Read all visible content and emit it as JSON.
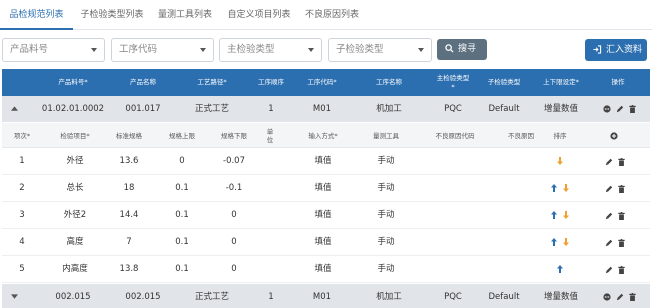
{
  "tabs": [
    {
      "label": "品检规范列表"
    },
    {
      "label": "子检验类型列表"
    },
    {
      "label": "量测工具列表"
    },
    {
      "label": "自定义项目列表"
    },
    {
      "label": "不良原因列表"
    }
  ],
  "filters": {
    "material_placeholder": "产品料号",
    "process_code_placeholder": "工序代码",
    "main_type_placeholder": "主检验类型",
    "sub_type_placeholder": "子检验类型",
    "search_label": "搜寻",
    "import_label": "汇入资料"
  },
  "columns": [
    "产品料号*",
    "产品名称",
    "工艺路径*",
    "工序顺序",
    "工序代码*",
    "工序名称",
    "主检验类型*",
    "子检验类型",
    "上下限设定*",
    "操作"
  ],
  "main_rows": [
    {
      "material": "01.02.01.0002",
      "name": "001.017",
      "route": "正式工艺",
      "seq": "1",
      "code": "M01",
      "process": "机加工",
      "main_type": "PQC",
      "sub_type": "Default",
      "limit": "增量数值"
    },
    {
      "material": "002.015",
      "name": "002.015",
      "route": "正式工艺",
      "seq": "1",
      "code": "M01",
      "process": "机加工",
      "main_type": "PQC",
      "sub_type": "Default",
      "limit": "增量数值"
    }
  ],
  "sub_columns": [
    "项次*",
    "检验项目*",
    "标准规格",
    "规格上限",
    "规格下限",
    "单位",
    "输入方式*",
    "量测工具",
    "不良原因代码",
    "不良原因",
    "排序"
  ],
  "sub_rows": [
    {
      "idx": "1",
      "item": "外径",
      "std": "13.6",
      "upper": "0",
      "lower": "-0.07",
      "unit": "",
      "input": "填值",
      "tool": "手动",
      "up": false,
      "down": true
    },
    {
      "idx": "2",
      "item": "总长",
      "std": "18",
      "upper": "0.1",
      "lower": "-0.1",
      "unit": "",
      "input": "填值",
      "tool": "手动",
      "up": true,
      "down": true
    },
    {
      "idx": "3",
      "item": "外径2",
      "std": "14.4",
      "upper": "0.1",
      "lower": "0",
      "unit": "",
      "input": "填值",
      "tool": "手动",
      "up": true,
      "down": true
    },
    {
      "idx": "4",
      "item": "高度",
      "std": "7",
      "upper": "0.1",
      "lower": "0",
      "unit": "",
      "input": "填值",
      "tool": "手动",
      "up": true,
      "down": true
    },
    {
      "idx": "5",
      "item": "内高度",
      "std": "13.8",
      "upper": "0.1",
      "lower": "0",
      "unit": "",
      "input": "填值",
      "tool": "手动",
      "up": true,
      "down": false
    }
  ],
  "colors": {
    "header_blue": "#2c6fb0",
    "arrow_up": "#2c6fb0",
    "arrow_down": "#f0a030"
  }
}
